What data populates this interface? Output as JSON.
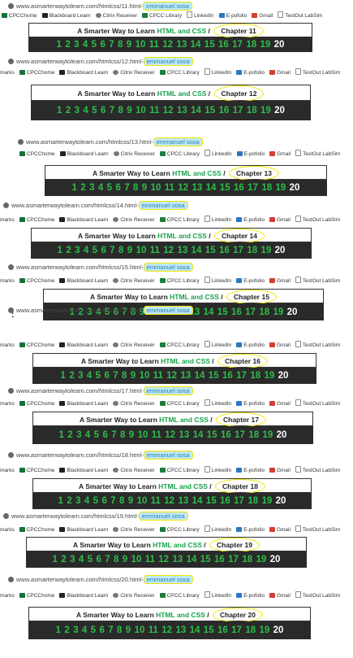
{
  "title": {
    "prefix": "A Smarter Way to Learn",
    "highlight": "HTML and CSS",
    "separator": "/"
  },
  "bookmarks": [
    "CPCChome",
    "Blackboard Learn",
    "Citrix Receiver",
    "CPCC Library",
    "LinkedIn",
    "E-pofolio",
    "Gmail",
    "TestOut LabSim"
  ],
  "marks_label": "marks",
  "chapter_numbers": [
    1,
    2,
    3,
    4,
    5,
    6,
    7,
    8,
    9,
    10,
    11,
    12,
    13,
    14,
    15,
    16,
    17,
    18,
    19,
    20
  ],
  "screens": [
    {
      "url_prefix": "www.asmarterwaytolearn.com/htmlcss/11.html-",
      "url_suffix": "emmanuel.sosa",
      "chapter": "Chapter 11",
      "current": "20"
    },
    {
      "url_prefix": "www.asmarterwaytolearn.com/htmlcss/12.html-",
      "url_suffix": "emmanuel sosa",
      "chapter": "Chapter 12",
      "current": "20"
    },
    {
      "url_prefix": "www.asmarterwaytolearn.com/htmlcss/13.html-",
      "url_suffix": "emmanuel sosa",
      "chapter": "Chapter 13",
      "current": "20"
    },
    {
      "url_prefix": "www.asmarterwaytolearn.com/htmlcss/14.html-",
      "url_suffix": "emmanuel sosa",
      "chapter": "Chapter 14",
      "current": "20"
    },
    {
      "url_prefix": "www.asmarterwaytolearn.com/htmlcss/15.html-",
      "url_suffix": "emmanuel sosa",
      "chapter": "Chapter 15",
      "current": "20"
    },
    {
      "url_prefix": "www.asmarterwaytolearn.com/htmlcss/16.html-",
      "url_suffix": "emmanuel sosa",
      "chapter": "Chapter 16",
      "current": "20"
    },
    {
      "url_prefix": "www.asmarterwaytolearn.com/htmlcss/17.html-",
      "url_suffix": "emmanuel sosa",
      "chapter": "Chapter 17",
      "current": "20"
    },
    {
      "url_prefix": "www.asmarterwaytolearn.com/htmlcss/18.html-",
      "url_suffix": "emmanuel sosa",
      "chapter": "Chapter 18",
      "current": "20"
    },
    {
      "url_prefix": "www.asmarterwaytolearn.com/htmlcss/19.html-",
      "url_suffix": "emmanuel sosa",
      "chapter": "Chapter 19",
      "current": "20"
    },
    {
      "url_prefix": "www.asmarterwaytolearn.com/htmlcss/20.html-",
      "url_suffix": "emmanuel sosa",
      "chapter": "Chapter 20",
      "current": "20"
    }
  ],
  "stray_mark": ":",
  "colors": {
    "accent_green": "#2ebd4a",
    "bar_bg": "#2a2a2a",
    "highlight": "#f2e600",
    "url_highlight": "#bfe9f6"
  }
}
